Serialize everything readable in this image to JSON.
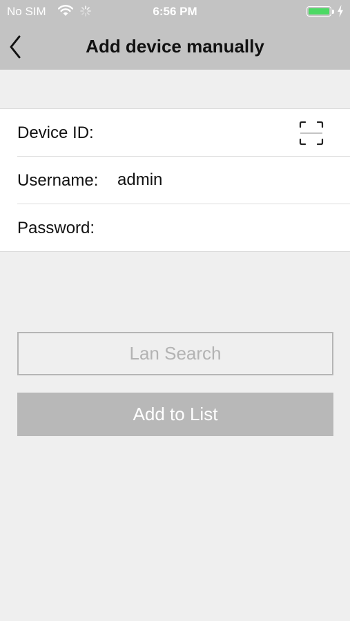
{
  "status_bar": {
    "carrier": "No SIM",
    "time": "6:56 PM",
    "battery_level": 1.0,
    "battery_color": "#4cd964",
    "icons": [
      "wifi-icon",
      "activity-spinner-icon",
      "battery-icon",
      "charging-bolt-icon"
    ]
  },
  "nav": {
    "title": "Add device manually",
    "back_icon": "chevron-left-icon"
  },
  "form": {
    "device_id": {
      "label": "Device ID:",
      "value": "",
      "placeholder": "",
      "scan_icon": "qr-scan-icon"
    },
    "username": {
      "label": "Username:",
      "value": "admin",
      "placeholder": ""
    },
    "password": {
      "label": "Password:",
      "value": "",
      "placeholder": ""
    }
  },
  "buttons": {
    "lan_search": "Lan Search",
    "add_to_list": "Add to List"
  },
  "colors": {
    "header_bg": "#c3c3c3",
    "page_bg": "#efefef",
    "button_disabled_bg": "#b8b8b8",
    "button_outline": "#b5b5b5"
  }
}
